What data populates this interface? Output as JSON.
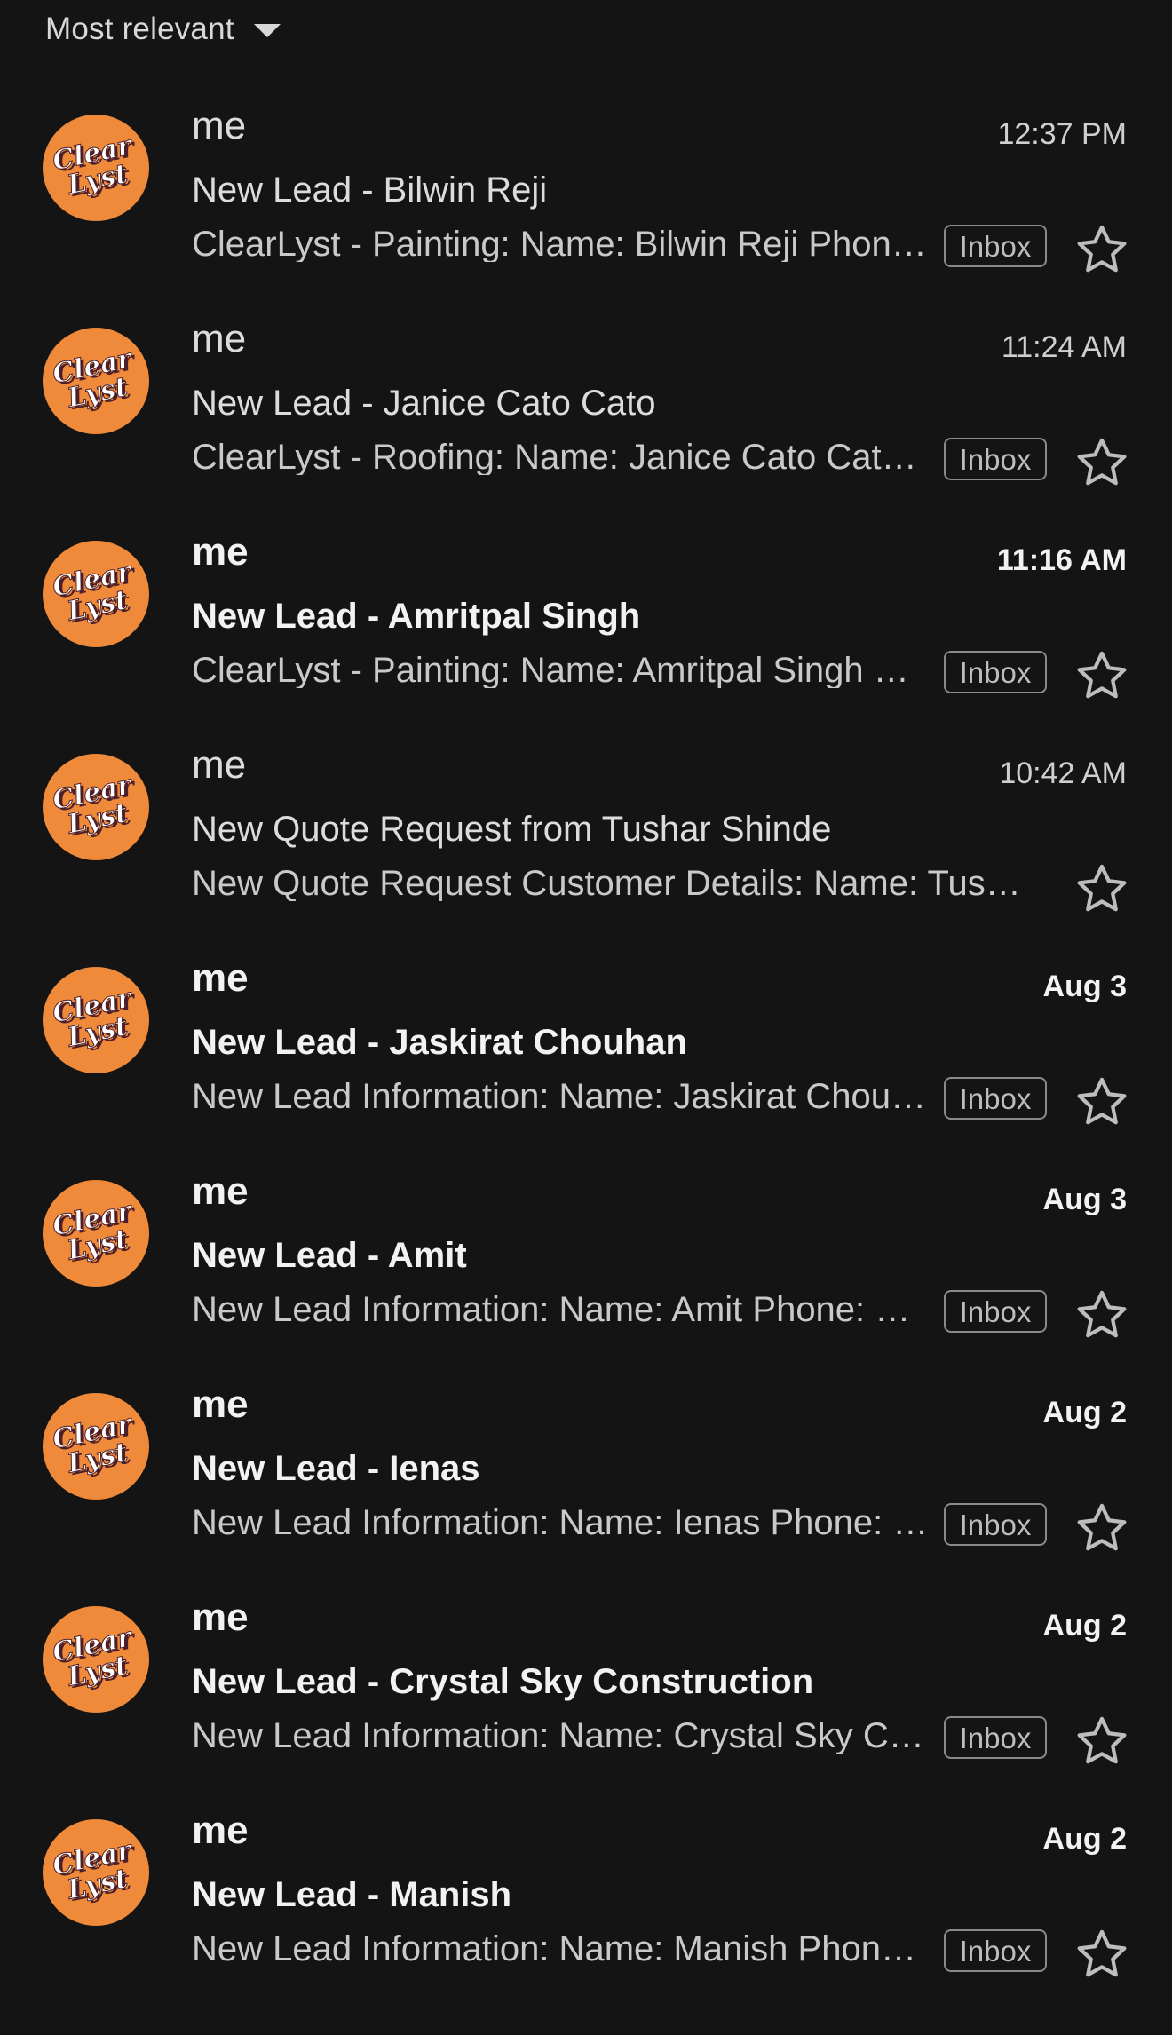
{
  "sort": {
    "label": "Most relevant",
    "icon": "caret-down-icon"
  },
  "avatar": {
    "icon": "clearlyst-logo-avatar",
    "color": "#ef8a3a",
    "brand_text": "ClearLyst"
  },
  "emails": [
    {
      "sender": "me",
      "time": "12:37 PM",
      "subject": "New Lead - Bilwin Reji",
      "preview": "ClearLyst - Painting: Name: Bilwin Reji Phone: …",
      "label": "Inbox",
      "unread": false,
      "starred": false
    },
    {
      "sender": "me",
      "time": "11:24 AM",
      "subject": "New Lead - Janice Cato Cato",
      "preview": "ClearLyst - Roofing: Name: Janice Cato Cato Phone: …",
      "label": "Inbox",
      "unread": false,
      "starred": false
    },
    {
      "sender": "me",
      "time": "11:16 AM",
      "subject": "New Lead - Amritpal Singh",
      "preview": "ClearLyst - Painting: Name: Amritpal Singh Phone: …",
      "label": "Inbox",
      "unread": true,
      "starred": false
    },
    {
      "sender": "me",
      "time": "10:42 AM",
      "subject": "New Quote Request from Tushar Shinde",
      "preview": "New Quote Request Customer Details: Name: Tushar Shinde",
      "label": "",
      "unread": false,
      "starred": false
    },
    {
      "sender": "me",
      "time": "Aug 3",
      "subject": "New Lead - Jaskirat Chouhan",
      "preview": "New Lead Information: Name: Jaskirat Chouhan Phone: …",
      "label": "Inbox",
      "unread": true,
      "starred": false
    },
    {
      "sender": "me",
      "time": "Aug 3",
      "subject": "New Lead - Amit",
      "preview": "New Lead Information: Name: Amit Phone: …",
      "label": "Inbox",
      "unread": true,
      "starred": false
    },
    {
      "sender": "me",
      "time": "Aug 2",
      "subject": "New Lead - Ienas",
      "preview": "New Lead Information: Name: Ienas Phone: …",
      "label": "Inbox",
      "unread": true,
      "starred": false
    },
    {
      "sender": "me",
      "time": "Aug 2",
      "subject": "New Lead - Crystal Sky Construction",
      "preview": "New Lead Information: Name: Crystal Sky Construction",
      "label": "Inbox",
      "unread": true,
      "starred": false
    },
    {
      "sender": "me",
      "time": "Aug 2",
      "subject": "New Lead - Manish",
      "preview": "New Lead Information: Name: Manish Phone: …",
      "label": "Inbox",
      "unread": true,
      "starred": false
    }
  ]
}
